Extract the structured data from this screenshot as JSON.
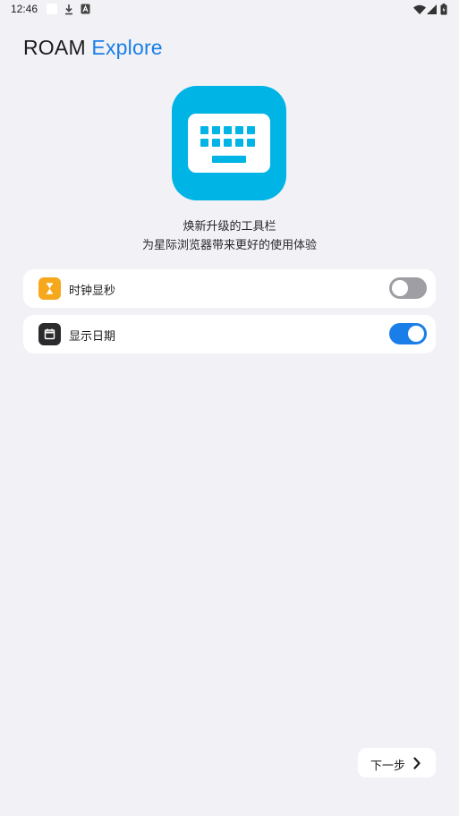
{
  "status_bar": {
    "time": "12:46",
    "left_icons": [
      "white-square-icon",
      "download-icon",
      "a-notification-icon"
    ],
    "right_icons": [
      "wifi-icon",
      "signal-icon",
      "battery-icon"
    ]
  },
  "header": {
    "title_part1": "ROAM",
    "title_part2": "Explore"
  },
  "hero": {
    "icon": "keyboard-icon",
    "line1": "焕新升级的工具栏",
    "line2": "为星际浏览器带来更好的使用体验"
  },
  "settings": [
    {
      "icon": "hourglass-icon",
      "label": "时钟显秒",
      "enabled": false
    },
    {
      "icon": "calendar-icon",
      "label": "显示日期",
      "enabled": true
    }
  ],
  "footer": {
    "next_label": "下一步",
    "next_icon": "chevron-right-icon"
  },
  "colors": {
    "background": "#f1f1f6",
    "accent": "#1a7ee8",
    "hero_bg": "#00b4e6",
    "clock_icon_bg": "#f5a81c",
    "date_icon_bg": "#2b2b2d",
    "toggle_off": "#9e9ea4"
  }
}
